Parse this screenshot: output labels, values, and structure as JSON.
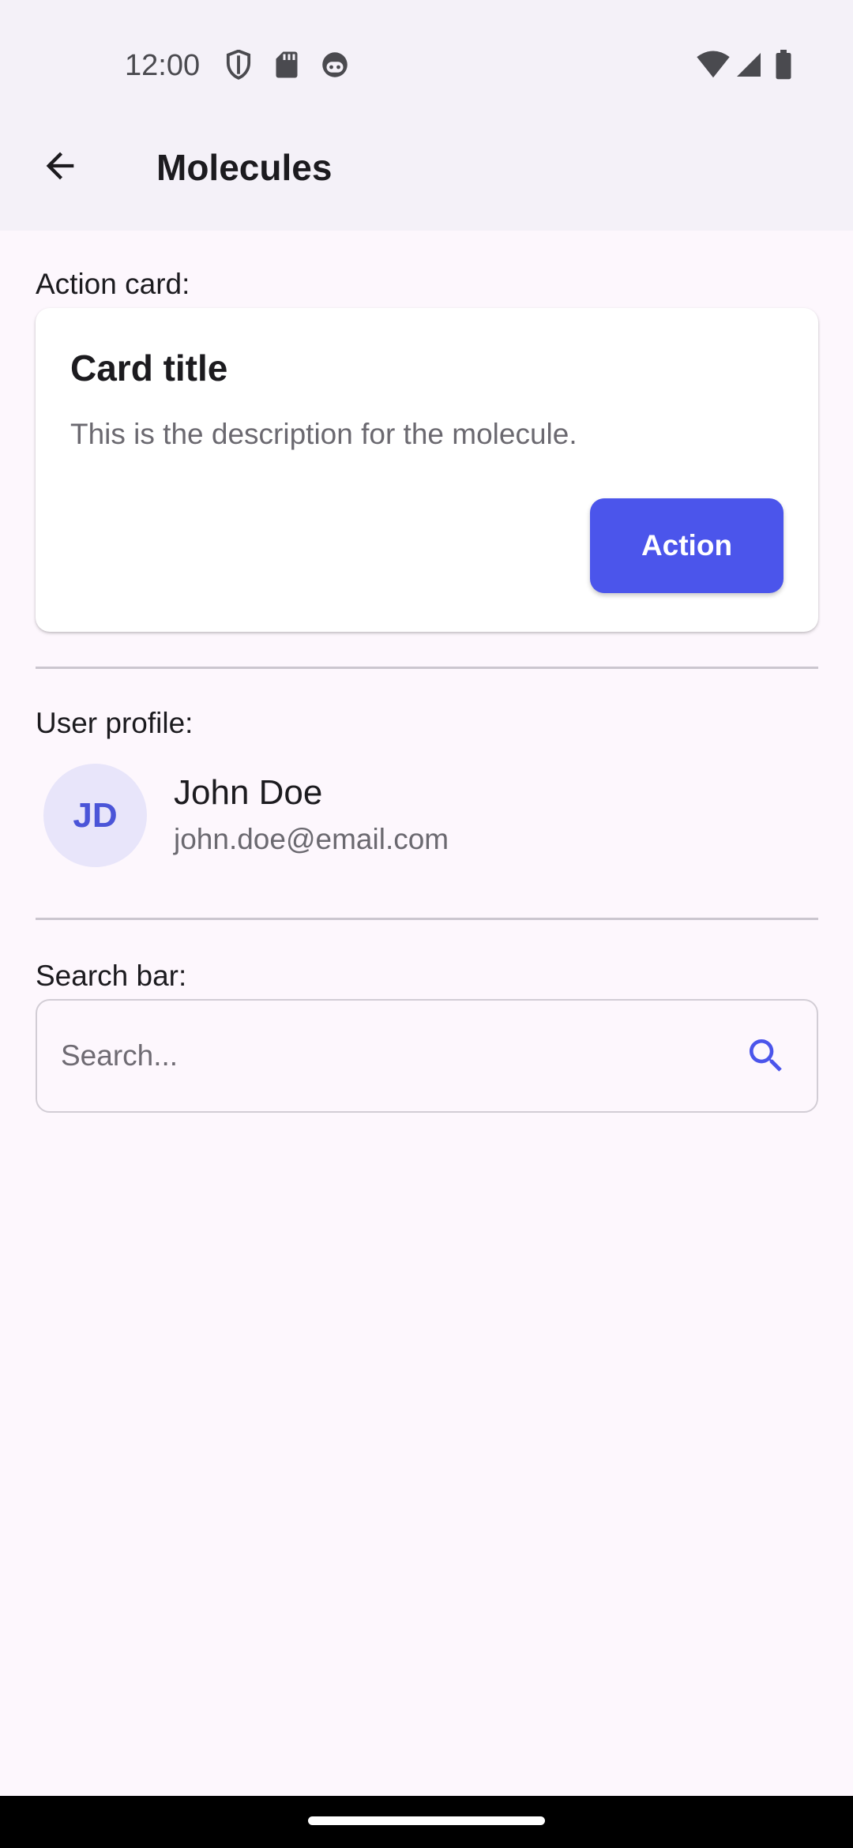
{
  "status_bar": {
    "time": "12:00",
    "left_icons": [
      "shield-icon",
      "sd-card-icon",
      "android-face-icon"
    ],
    "right_icons": [
      "wifi-icon",
      "cell-signal-icon",
      "battery-icon"
    ]
  },
  "app_bar": {
    "back_icon": "arrow-back-icon",
    "title": "Molecules"
  },
  "action_card_section": {
    "label": "Action card:",
    "card": {
      "title": "Card title",
      "description": "This is the description for the molecule.",
      "button_label": "Action"
    }
  },
  "user_profile_section": {
    "label": "User profile:",
    "initials": "JD",
    "name": "John Doe",
    "email": "john.doe@email.com"
  },
  "search_section": {
    "label": "Search bar:",
    "placeholder": "Search...",
    "value": "",
    "icon": "search-icon"
  },
  "colors": {
    "accent": "#4b55eb",
    "background": "#fdf7fd",
    "app_bar": "#f4f1f8",
    "avatar_bg": "#e8e5fa"
  }
}
